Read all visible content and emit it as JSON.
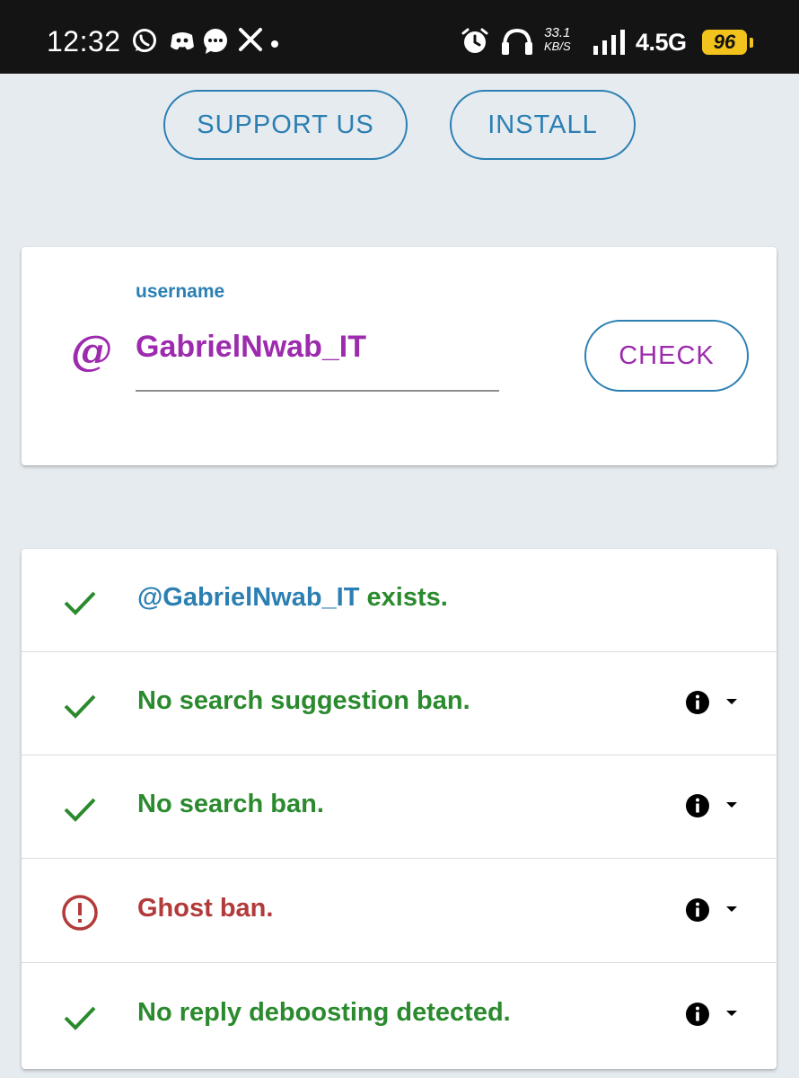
{
  "status_bar": {
    "time": "12:32",
    "net_speed_value": "33.1",
    "net_speed_unit": "KB/S",
    "network_type": "4.5G",
    "battery": "96",
    "icons": [
      "whatsapp-icon",
      "discord-icon",
      "chat-bubble-icon",
      "x-icon",
      "dot-icon",
      "alarm-icon",
      "headphones-icon",
      "signal-icon"
    ]
  },
  "top_buttons": {
    "support_label": "SUPPORT US",
    "install_label": "INSTALL"
  },
  "username_form": {
    "prefix_symbol": "@",
    "label": "username",
    "value": "GabrielNwab_IT",
    "check_label": "CHECK"
  },
  "results": [
    {
      "status": "ok",
      "handle": "@GabrielNwab_IT",
      "text": " exists.",
      "has_info": false
    },
    {
      "status": "ok",
      "text": "No search suggestion ban.",
      "has_info": true
    },
    {
      "status": "ok",
      "text": "No search ban.",
      "has_info": true
    },
    {
      "status": "warning",
      "text": "Ghost ban.",
      "has_info": true
    },
    {
      "status": "ok",
      "text": "No reply deboosting detected.",
      "has_info": true
    }
  ],
  "colors": {
    "accent_blue": "#2b7fb3",
    "accent_purple": "#9c2bad",
    "ok_green": "#2b8a2e",
    "warn_red": "#b23a3a",
    "background": "#e6ebf0",
    "battery_yellow": "#f2c21d"
  }
}
